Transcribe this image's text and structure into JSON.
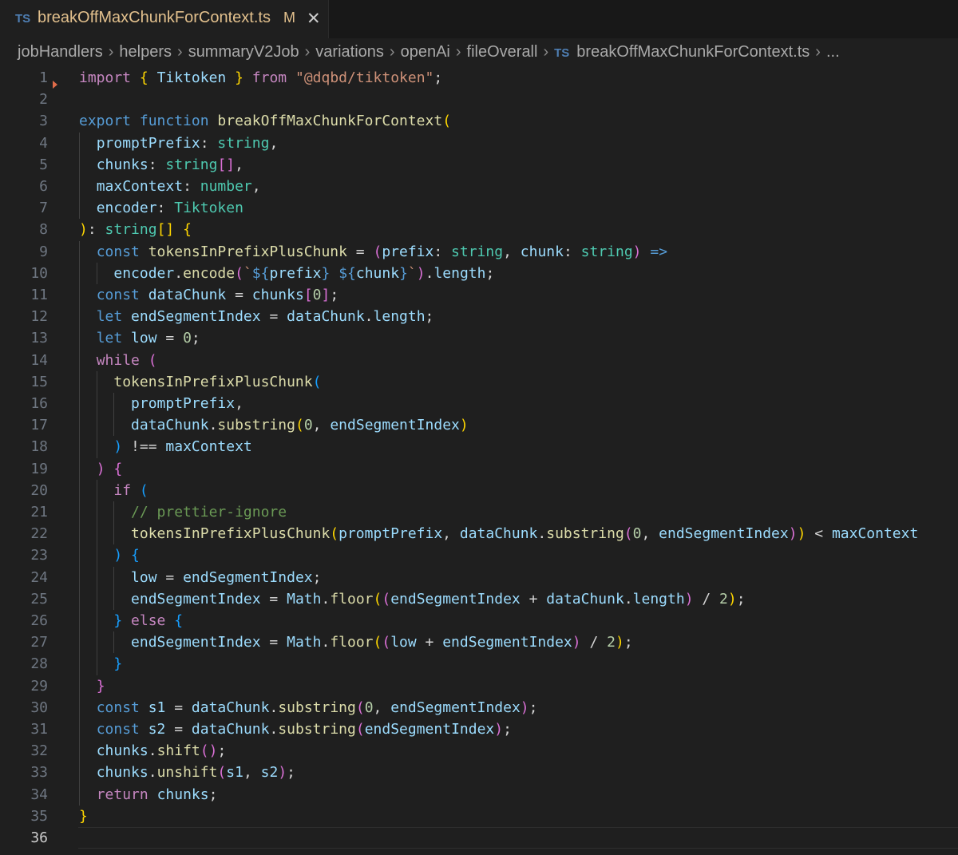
{
  "tab": {
    "lang_icon": "TS",
    "filename": "breakOffMaxChunkForContext.ts",
    "modified": "M",
    "close": "✕"
  },
  "breadcrumb": {
    "items": [
      "jobHandlers",
      "helpers",
      "summaryV2Job",
      "variations",
      "openAi",
      "fileOverall"
    ],
    "file_icon": "TS",
    "file": "breakOffMaxChunkForContext.ts",
    "more": "..."
  },
  "colors": {
    "keyword": "#c586c0",
    "storage": "#569cd6",
    "function": "#dcdcaa",
    "variable": "#9cdcfe",
    "type": "#4ec9b0",
    "string": "#ce9178",
    "number": "#b5cea8",
    "comment": "#6a9955",
    "bracket_gold": "#ffd700",
    "bracket_purple": "#da70d6",
    "bracket_blue": "#179fff"
  },
  "editor": {
    "active_line": 36,
    "lines": [
      [
        [
          "k",
          "import"
        ],
        [
          "p",
          " "
        ],
        [
          "b1",
          "{"
        ],
        [
          "p",
          " "
        ],
        [
          "v",
          "Tiktoken"
        ],
        [
          "p",
          " "
        ],
        [
          "b1",
          "}"
        ],
        [
          "p",
          " "
        ],
        [
          "k",
          "from"
        ],
        [
          "p",
          " "
        ],
        [
          "s",
          "\"@dqbd/tiktoken\""
        ],
        [
          "p",
          ";"
        ]
      ],
      [],
      [
        [
          "st",
          "export"
        ],
        [
          "p",
          " "
        ],
        [
          "st",
          "function"
        ],
        [
          "p",
          " "
        ],
        [
          "f",
          "breakOffMaxChunkForContext"
        ],
        [
          "b1",
          "("
        ]
      ],
      [
        [
          "p",
          "  "
        ],
        [
          "v",
          "promptPrefix"
        ],
        [
          "p",
          ": "
        ],
        [
          "t",
          "string"
        ],
        [
          "p",
          ","
        ]
      ],
      [
        [
          "p",
          "  "
        ],
        [
          "v",
          "chunks"
        ],
        [
          "p",
          ": "
        ],
        [
          "t",
          "string"
        ],
        [
          "b2",
          "[]"
        ],
        [
          "p",
          ","
        ]
      ],
      [
        [
          "p",
          "  "
        ],
        [
          "v",
          "maxContext"
        ],
        [
          "p",
          ": "
        ],
        [
          "t",
          "number"
        ],
        [
          "p",
          ","
        ]
      ],
      [
        [
          "p",
          "  "
        ],
        [
          "v",
          "encoder"
        ],
        [
          "p",
          ": "
        ],
        [
          "t",
          "Tiktoken"
        ]
      ],
      [
        [
          "b1",
          ")"
        ],
        [
          "p",
          ": "
        ],
        [
          "t",
          "string"
        ],
        [
          "b1",
          "[]"
        ],
        [
          "p",
          " "
        ],
        [
          "b1",
          "{"
        ]
      ],
      [
        [
          "p",
          "  "
        ],
        [
          "st",
          "const"
        ],
        [
          "p",
          " "
        ],
        [
          "f",
          "tokensInPrefixPlusChunk"
        ],
        [
          "p",
          " = "
        ],
        [
          "b2",
          "("
        ],
        [
          "v",
          "prefix"
        ],
        [
          "p",
          ": "
        ],
        [
          "t",
          "string"
        ],
        [
          "p",
          ", "
        ],
        [
          "v",
          "chunk"
        ],
        [
          "p",
          ": "
        ],
        [
          "t",
          "string"
        ],
        [
          "b2",
          ")"
        ],
        [
          "p",
          " "
        ],
        [
          "st",
          "=>"
        ]
      ],
      [
        [
          "p",
          "    "
        ],
        [
          "v",
          "encoder"
        ],
        [
          "p",
          "."
        ],
        [
          "f",
          "encode"
        ],
        [
          "b2",
          "("
        ],
        [
          "s",
          "`"
        ],
        [
          "st",
          "${"
        ],
        [
          "v",
          "prefix"
        ],
        [
          "st",
          "}"
        ],
        [
          "s",
          " "
        ],
        [
          "st",
          "${"
        ],
        [
          "v",
          "chunk"
        ],
        [
          "st",
          "}"
        ],
        [
          "s",
          "`"
        ],
        [
          "b2",
          ")"
        ],
        [
          "p",
          "."
        ],
        [
          "v",
          "length"
        ],
        [
          "p",
          ";"
        ]
      ],
      [
        [
          "p",
          "  "
        ],
        [
          "st",
          "const"
        ],
        [
          "p",
          " "
        ],
        [
          "v",
          "dataChunk"
        ],
        [
          "p",
          " = "
        ],
        [
          "v",
          "chunks"
        ],
        [
          "b2",
          "["
        ],
        [
          "n",
          "0"
        ],
        [
          "b2",
          "]"
        ],
        [
          "p",
          ";"
        ]
      ],
      [
        [
          "p",
          "  "
        ],
        [
          "st",
          "let"
        ],
        [
          "p",
          " "
        ],
        [
          "v",
          "endSegmentIndex"
        ],
        [
          "p",
          " = "
        ],
        [
          "v",
          "dataChunk"
        ],
        [
          "p",
          "."
        ],
        [
          "v",
          "length"
        ],
        [
          "p",
          ";"
        ]
      ],
      [
        [
          "p",
          "  "
        ],
        [
          "st",
          "let"
        ],
        [
          "p",
          " "
        ],
        [
          "v",
          "low"
        ],
        [
          "p",
          " = "
        ],
        [
          "n",
          "0"
        ],
        [
          "p",
          ";"
        ]
      ],
      [
        [
          "p",
          "  "
        ],
        [
          "k",
          "while"
        ],
        [
          "p",
          " "
        ],
        [
          "b2",
          "("
        ]
      ],
      [
        [
          "p",
          "    "
        ],
        [
          "f",
          "tokensInPrefixPlusChunk"
        ],
        [
          "b3",
          "("
        ]
      ],
      [
        [
          "p",
          "      "
        ],
        [
          "v",
          "promptPrefix"
        ],
        [
          "p",
          ","
        ]
      ],
      [
        [
          "p",
          "      "
        ],
        [
          "v",
          "dataChunk"
        ],
        [
          "p",
          "."
        ],
        [
          "f",
          "substring"
        ],
        [
          "b1",
          "("
        ],
        [
          "n",
          "0"
        ],
        [
          "p",
          ", "
        ],
        [
          "v",
          "endSegmentIndex"
        ],
        [
          "b1",
          ")"
        ]
      ],
      [
        [
          "p",
          "    "
        ],
        [
          "b3",
          ")"
        ],
        [
          "p",
          " !== "
        ],
        [
          "v",
          "maxContext"
        ]
      ],
      [
        [
          "p",
          "  "
        ],
        [
          "b2",
          ")"
        ],
        [
          "p",
          " "
        ],
        [
          "b2",
          "{"
        ]
      ],
      [
        [
          "p",
          "    "
        ],
        [
          "k",
          "if"
        ],
        [
          "p",
          " "
        ],
        [
          "b3",
          "("
        ]
      ],
      [
        [
          "p",
          "      "
        ],
        [
          "c",
          "// prettier-ignore"
        ]
      ],
      [
        [
          "p",
          "      "
        ],
        [
          "f",
          "tokensInPrefixPlusChunk"
        ],
        [
          "b1",
          "("
        ],
        [
          "v",
          "promptPrefix"
        ],
        [
          "p",
          ", "
        ],
        [
          "v",
          "dataChunk"
        ],
        [
          "p",
          "."
        ],
        [
          "f",
          "substring"
        ],
        [
          "b2",
          "("
        ],
        [
          "n",
          "0"
        ],
        [
          "p",
          ", "
        ],
        [
          "v",
          "endSegmentIndex"
        ],
        [
          "b2",
          ")"
        ],
        [
          "b1",
          ")"
        ],
        [
          "p",
          " < "
        ],
        [
          "v",
          "maxContext"
        ]
      ],
      [
        [
          "p",
          "    "
        ],
        [
          "b3",
          ")"
        ],
        [
          "p",
          " "
        ],
        [
          "b3",
          "{"
        ]
      ],
      [
        [
          "p",
          "      "
        ],
        [
          "v",
          "low"
        ],
        [
          "p",
          " = "
        ],
        [
          "v",
          "endSegmentIndex"
        ],
        [
          "p",
          ";"
        ]
      ],
      [
        [
          "p",
          "      "
        ],
        [
          "v",
          "endSegmentIndex"
        ],
        [
          "p",
          " = "
        ],
        [
          "v",
          "Math"
        ],
        [
          "p",
          "."
        ],
        [
          "f",
          "floor"
        ],
        [
          "b1",
          "("
        ],
        [
          "b2",
          "("
        ],
        [
          "v",
          "endSegmentIndex"
        ],
        [
          "p",
          " + "
        ],
        [
          "v",
          "dataChunk"
        ],
        [
          "p",
          "."
        ],
        [
          "v",
          "length"
        ],
        [
          "b2",
          ")"
        ],
        [
          "p",
          " / "
        ],
        [
          "n",
          "2"
        ],
        [
          "b1",
          ")"
        ],
        [
          "p",
          ";"
        ]
      ],
      [
        [
          "p",
          "    "
        ],
        [
          "b3",
          "}"
        ],
        [
          "p",
          " "
        ],
        [
          "k",
          "else"
        ],
        [
          "p",
          " "
        ],
        [
          "b3",
          "{"
        ]
      ],
      [
        [
          "p",
          "      "
        ],
        [
          "v",
          "endSegmentIndex"
        ],
        [
          "p",
          " = "
        ],
        [
          "v",
          "Math"
        ],
        [
          "p",
          "."
        ],
        [
          "f",
          "floor"
        ],
        [
          "b1",
          "("
        ],
        [
          "b2",
          "("
        ],
        [
          "v",
          "low"
        ],
        [
          "p",
          " + "
        ],
        [
          "v",
          "endSegmentIndex"
        ],
        [
          "b2",
          ")"
        ],
        [
          "p",
          " / "
        ],
        [
          "n",
          "2"
        ],
        [
          "b1",
          ")"
        ],
        [
          "p",
          ";"
        ]
      ],
      [
        [
          "p",
          "    "
        ],
        [
          "b3",
          "}"
        ]
      ],
      [
        [
          "p",
          "  "
        ],
        [
          "b2",
          "}"
        ]
      ],
      [
        [
          "p",
          "  "
        ],
        [
          "st",
          "const"
        ],
        [
          "p",
          " "
        ],
        [
          "v",
          "s1"
        ],
        [
          "p",
          " = "
        ],
        [
          "v",
          "dataChunk"
        ],
        [
          "p",
          "."
        ],
        [
          "f",
          "substring"
        ],
        [
          "b2",
          "("
        ],
        [
          "n",
          "0"
        ],
        [
          "p",
          ", "
        ],
        [
          "v",
          "endSegmentIndex"
        ],
        [
          "b2",
          ")"
        ],
        [
          "p",
          ";"
        ]
      ],
      [
        [
          "p",
          "  "
        ],
        [
          "st",
          "const"
        ],
        [
          "p",
          " "
        ],
        [
          "v",
          "s2"
        ],
        [
          "p",
          " = "
        ],
        [
          "v",
          "dataChunk"
        ],
        [
          "p",
          "."
        ],
        [
          "f",
          "substring"
        ],
        [
          "b2",
          "("
        ],
        [
          "v",
          "endSegmentIndex"
        ],
        [
          "b2",
          ")"
        ],
        [
          "p",
          ";"
        ]
      ],
      [
        [
          "p",
          "  "
        ],
        [
          "v",
          "chunks"
        ],
        [
          "p",
          "."
        ],
        [
          "f",
          "shift"
        ],
        [
          "b2",
          "()"
        ],
        [
          "p",
          ";"
        ]
      ],
      [
        [
          "p",
          "  "
        ],
        [
          "v",
          "chunks"
        ],
        [
          "p",
          "."
        ],
        [
          "f",
          "unshift"
        ],
        [
          "b2",
          "("
        ],
        [
          "v",
          "s1"
        ],
        [
          "p",
          ", "
        ],
        [
          "v",
          "s2"
        ],
        [
          "b2",
          ")"
        ],
        [
          "p",
          ";"
        ]
      ],
      [
        [
          "p",
          "  "
        ],
        [
          "k",
          "return"
        ],
        [
          "p",
          " "
        ],
        [
          "v",
          "chunks"
        ],
        [
          "p",
          ";"
        ]
      ],
      [
        [
          "b1",
          "}"
        ]
      ],
      []
    ]
  }
}
